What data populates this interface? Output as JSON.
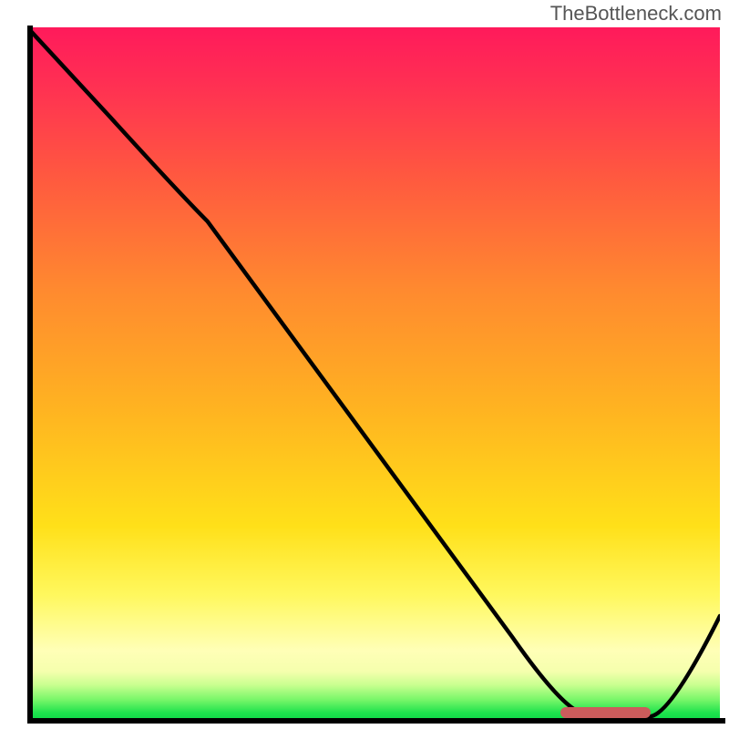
{
  "watermark": "TheBottleneck.com",
  "colors": {
    "axis": "#000000",
    "curve": "#000000",
    "marker": "#cc5c5c",
    "gradient_top": "#ff1a5b",
    "gradient_bottom": "#0fd948"
  },
  "chart_data": {
    "type": "line",
    "title": "",
    "xlabel": "",
    "ylabel": "",
    "xlim": [
      0,
      100
    ],
    "ylim": [
      0,
      100
    ],
    "x": [
      0,
      25,
      80,
      92,
      100
    ],
    "values": [
      100,
      73,
      1,
      0.5,
      15
    ],
    "marker": {
      "x_start": 77,
      "x_end": 90,
      "y": 1
    },
    "notes": "Implied axes with no visible tick labels. Curve descends from top-left, inflects around x≈25, reaches minimum plateau ~x 77–90 near y≈0, then rises toward x=100 y≈15. Background encodes value via color gradient (red high → green low)."
  }
}
